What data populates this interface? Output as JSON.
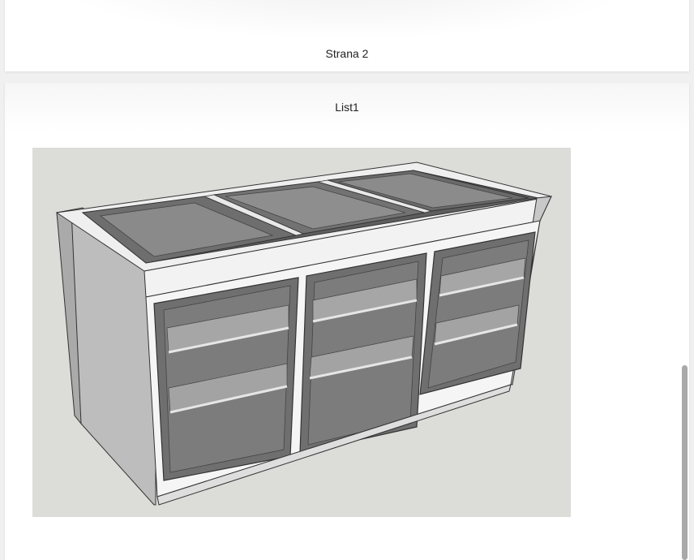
{
  "pages": [
    {
      "label": "Strana 2"
    },
    {
      "label": "List1"
    }
  ],
  "drawing": {
    "subject": "sketch-of-glass-display-cabinet",
    "background_color": "#dcdcd8"
  },
  "scrollbar": {
    "position": 0.65
  }
}
